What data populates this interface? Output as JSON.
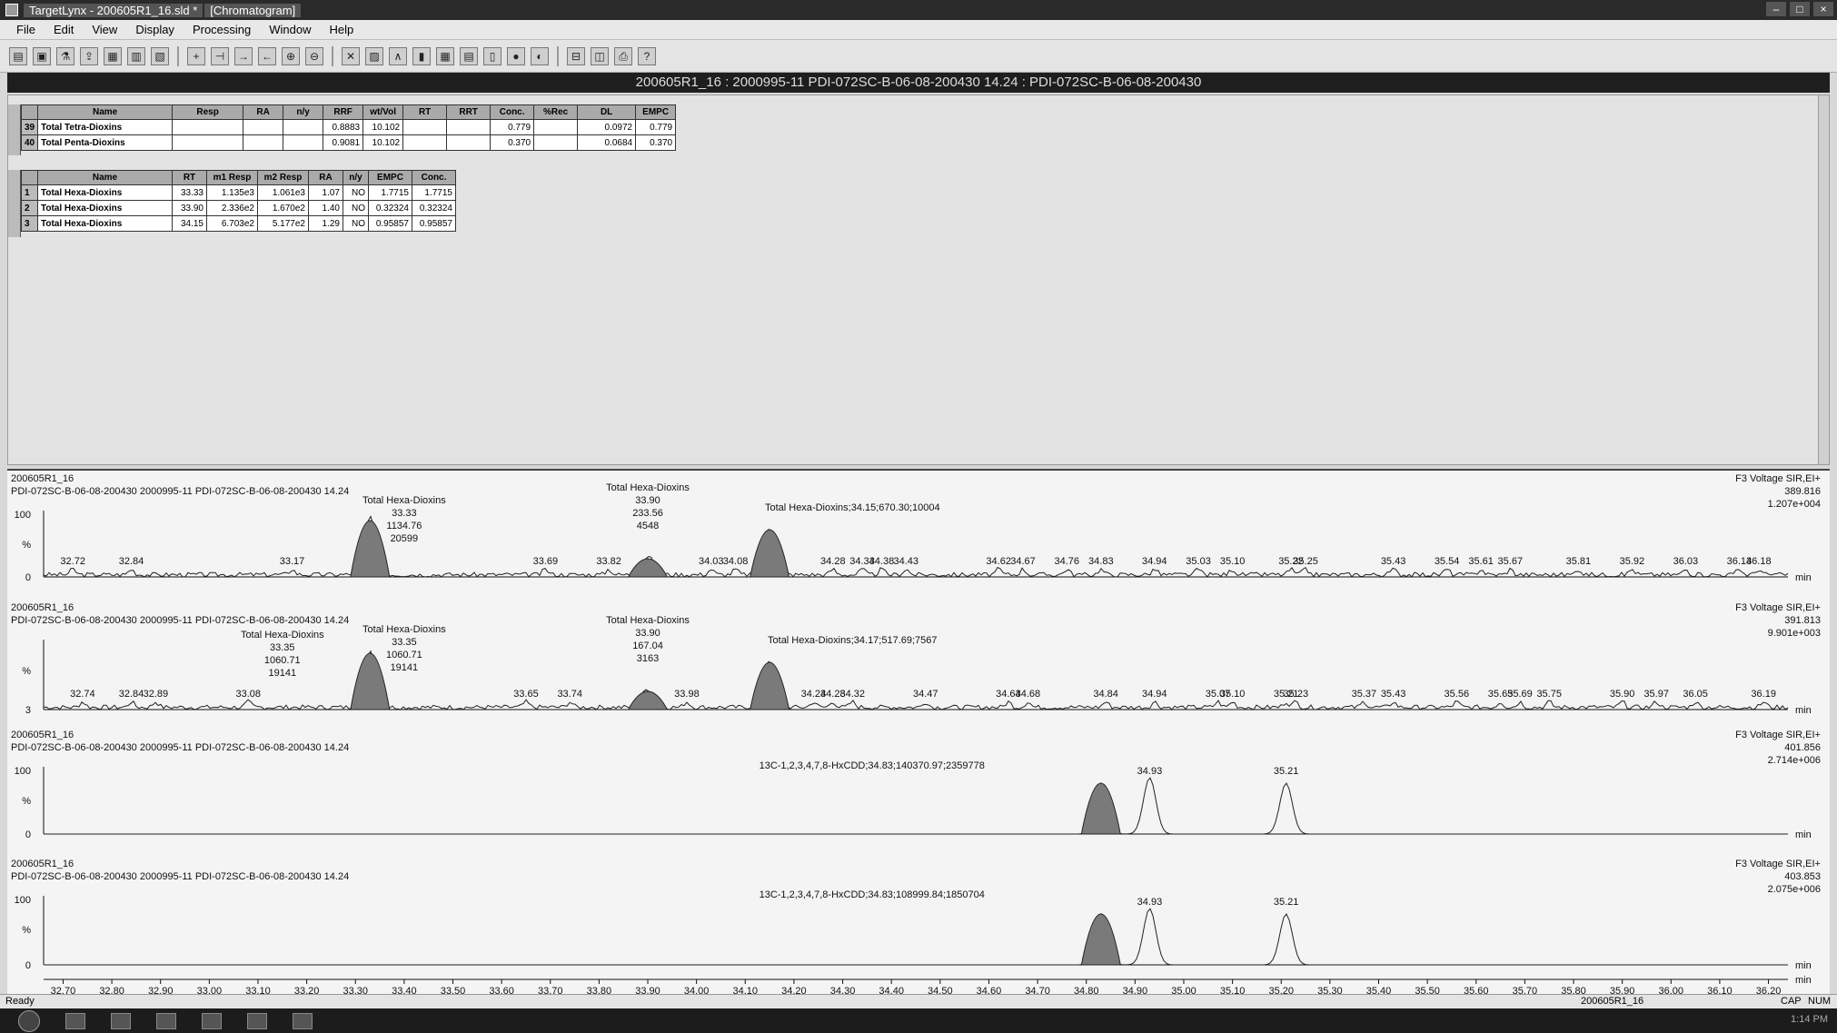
{
  "window": {
    "title_segments": [
      "TargetLynx - 200605R1_16.sld *",
      "[Chromatogram]"
    ],
    "controls": [
      "–",
      "□",
      "×"
    ]
  },
  "menu": [
    "File",
    "Edit",
    "View",
    "Display",
    "Processing",
    "Window",
    "Help"
  ],
  "toolbar_icons": [
    "open-icon",
    "save-icon",
    "process-icon",
    "export-icon",
    "report-icon",
    "view-icon",
    "print-preview-icon",
    "add-peak-icon",
    "split-icon",
    "next-icon",
    "prev-icon",
    "zoom-in-icon",
    "zoom-out-icon",
    "reset-zoom-icon",
    "chrom-icon",
    "spectrum-icon",
    "bar-icon",
    "grid-icon",
    "table-icon",
    "book-icon",
    "record-icon",
    "pie-icon",
    "layout-h-icon",
    "layout-v-icon",
    "print-icon",
    "help-icon"
  ],
  "sample_header": "200605R1_16 : 2000995-11 PDI-072SC-B-06-08-200430 14.24 : PDI-072SC-B-06-08-200430",
  "table1": {
    "headers": [
      "",
      "Name",
      "Resp",
      "RA",
      "n/y",
      "RRF",
      "wt/Vol",
      "RT",
      "RRT",
      "Conc.",
      "%Rec",
      "DL",
      "EMPC"
    ],
    "rows": [
      [
        "39",
        "Total Tetra-Dioxins",
        "",
        "",
        "",
        "0.8883",
        "10.102",
        "",
        "",
        "0.779",
        "",
        "0.0972",
        "0.779"
      ],
      [
        "40",
        "Total Penta-Dioxins",
        "",
        "",
        "",
        "0.9081",
        "10.102",
        "",
        "",
        "0.370",
        "",
        "0.0684",
        "0.370"
      ]
    ]
  },
  "table2": {
    "headers": [
      "",
      "Name",
      "RT",
      "m1 Resp",
      "m2 Resp",
      "RA",
      "n/y",
      "EMPC",
      "Conc."
    ],
    "rows": [
      [
        "1",
        "Total Hexa-Dioxins",
        "33.33",
        "1.135e3",
        "1.061e3",
        "1.07",
        "NO",
        "1.7715",
        "1.7715"
      ],
      [
        "2",
        "Total Hexa-Dioxins",
        "33.90",
        "2.336e2",
        "1.670e2",
        "1.40",
        "NO",
        "0.32324",
        "0.32324"
      ],
      [
        "3",
        "Total Hexa-Dioxins",
        "34.15",
        "6.703e2",
        "5.177e2",
        "1.29",
        "NO",
        "0.95857",
        "0.95857"
      ]
    ]
  },
  "chromatograms": [
    {
      "file": "200605R1_16",
      "sample": "PDI-072SC-B-06-08-200430 2000995-11 PDI-072SC-B-06-08-200430 14.24",
      "func": "F3 Voltage SIR,EI+",
      "mass": "389.816",
      "intensity": "1.207e+004",
      "yticks": [
        "100",
        "%",
        "0"
      ],
      "peaks": [
        "32.72",
        "32.84",
        "33.17",
        "33.69",
        "33.82",
        "34.03",
        "34.08",
        "34.28",
        "34.34",
        "34.38",
        "34.43",
        "34.62",
        "34.67",
        "34.76",
        "34.83",
        "34.94",
        "35.03",
        "35.10",
        "35.22",
        "35.25",
        "35.43",
        "35.54",
        "35.61",
        "35.67",
        "35.81",
        "35.92",
        "36.03",
        "36.14",
        "36.18"
      ],
      "annotations": [
        {
          "lines": [
            "Total Hexa-Dioxins",
            "33.33",
            "1134.76",
            "20599"
          ]
        },
        {
          "lines": [
            "Total Hexa-Dioxins",
            "33.90",
            "233.56",
            "4548"
          ]
        },
        {
          "lines": [
            "Total Hexa-Dioxins;34.15;670.30;10004"
          ]
        }
      ]
    },
    {
      "file": "200605R1_16",
      "sample": "PDI-072SC-B-06-08-200430 2000995-11 PDI-072SC-B-06-08-200430 14.24",
      "func": "F3 Voltage SIR,EI+",
      "mass": "391.813",
      "intensity": "9.901e+003",
      "yticks": [
        "%",
        "3"
      ],
      "peaks": [
        "32.74",
        "32.84",
        "32.89",
        "33.08",
        "33.65",
        "33.74",
        "33.98",
        "34.24",
        "34.28",
        "34.32",
        "34.47",
        "34.64",
        "34.68",
        "34.84",
        "34.94",
        "35.07",
        "35.10",
        "35.21",
        "35.23",
        "35.37",
        "35.43",
        "35.56",
        "35.65",
        "35.69",
        "35.75",
        "35.90",
        "35.97",
        "36.05",
        "36.19"
      ],
      "annotations": [
        {
          "lines": [
            "Total Hexa-Dioxins",
            "33.35",
            "1060.71",
            "19141"
          ]
        },
        {
          "lines": [
            "Total Hexa-Dioxins",
            "33.35",
            "1060.71",
            "19141"
          ]
        },
        {
          "lines": [
            "Total Hexa-Dioxins",
            "33.90",
            "167.04",
            "3163"
          ]
        },
        {
          "lines": [
            "Total Hexa-Dioxins;34.17;517.69;7567"
          ]
        }
      ]
    },
    {
      "file": "200605R1_16",
      "sample": "PDI-072SC-B-06-08-200430 2000995-11 PDI-072SC-B-06-08-200430 14.24",
      "func": "F3 Voltage SIR,EI+",
      "mass": "401.856",
      "intensity": "2.714e+006",
      "yticks": [
        "100",
        "%",
        "0"
      ],
      "peaks": [
        "34.93",
        "35.21"
      ],
      "annotations": [
        {
          "lines": [
            "13C-1,2,3,4,7,8-HxCDD;34.83;140370.97;2359778"
          ]
        }
      ]
    },
    {
      "file": "200605R1_16",
      "sample": "PDI-072SC-B-06-08-200430 2000995-11 PDI-072SC-B-06-08-200430 14.24",
      "func": "F3 Voltage SIR,EI+",
      "mass": "403.853",
      "intensity": "2.075e+006",
      "yticks": [
        "100",
        "%",
        "0"
      ],
      "peaks": [
        "34.93",
        "35.21"
      ],
      "annotations": [
        {
          "lines": [
            "13C-1,2,3,4,7,8-HxCDD;34.83;108999.84;1850704"
          ]
        }
      ]
    }
  ],
  "x_axis": {
    "ticks": [
      "32.70",
      "32.80",
      "32.90",
      "33.00",
      "33.10",
      "33.20",
      "33.30",
      "33.40",
      "33.50",
      "33.60",
      "33.70",
      "33.80",
      "33.90",
      "34.00",
      "34.10",
      "34.20",
      "34.30",
      "34.40",
      "34.50",
      "34.60",
      "34.70",
      "34.80",
      "34.90",
      "35.00",
      "35.10",
      "35.20",
      "35.30",
      "35.40",
      "35.50",
      "35.60",
      "35.70",
      "35.80",
      "35.90",
      "36.00",
      "36.10",
      "36.20"
    ],
    "unit": "min"
  },
  "status": {
    "ready": "Ready",
    "file": "200605R1_16",
    "cap": "CAP",
    "num": "NUM"
  },
  "taskbar": {
    "tray": "1:14 PM"
  }
}
